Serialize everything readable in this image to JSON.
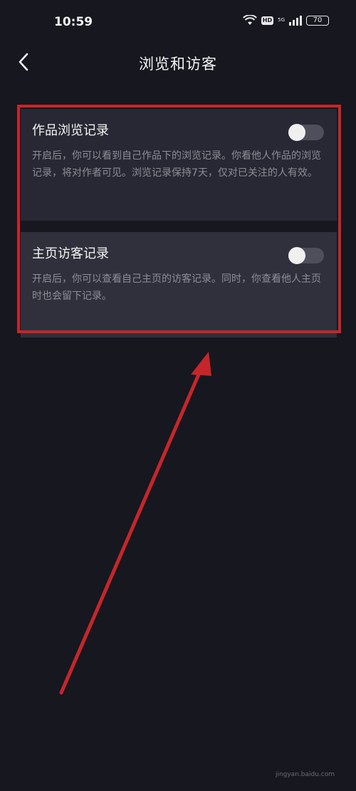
{
  "status_bar": {
    "time": "10:59",
    "hd": "HD",
    "network": "5G",
    "battery": "70"
  },
  "nav": {
    "title": "浏览和访客"
  },
  "settings": [
    {
      "title": "作品浏览记录",
      "description": "开启后，你可以看到自己作品下的浏览记录。你看他人作品的浏览记录，将对作者可见。浏览记录保持7天，仅对已关注的人有效。",
      "enabled": false
    },
    {
      "title": "主页访客记录",
      "description": "开启后，你可以查看自己主页的访客记录。同时，你查看他人主页时也会留下记录。",
      "enabled": false
    }
  ],
  "annotation": {
    "color": "#c5262a"
  },
  "watermark": "jingyan.baidu.com"
}
